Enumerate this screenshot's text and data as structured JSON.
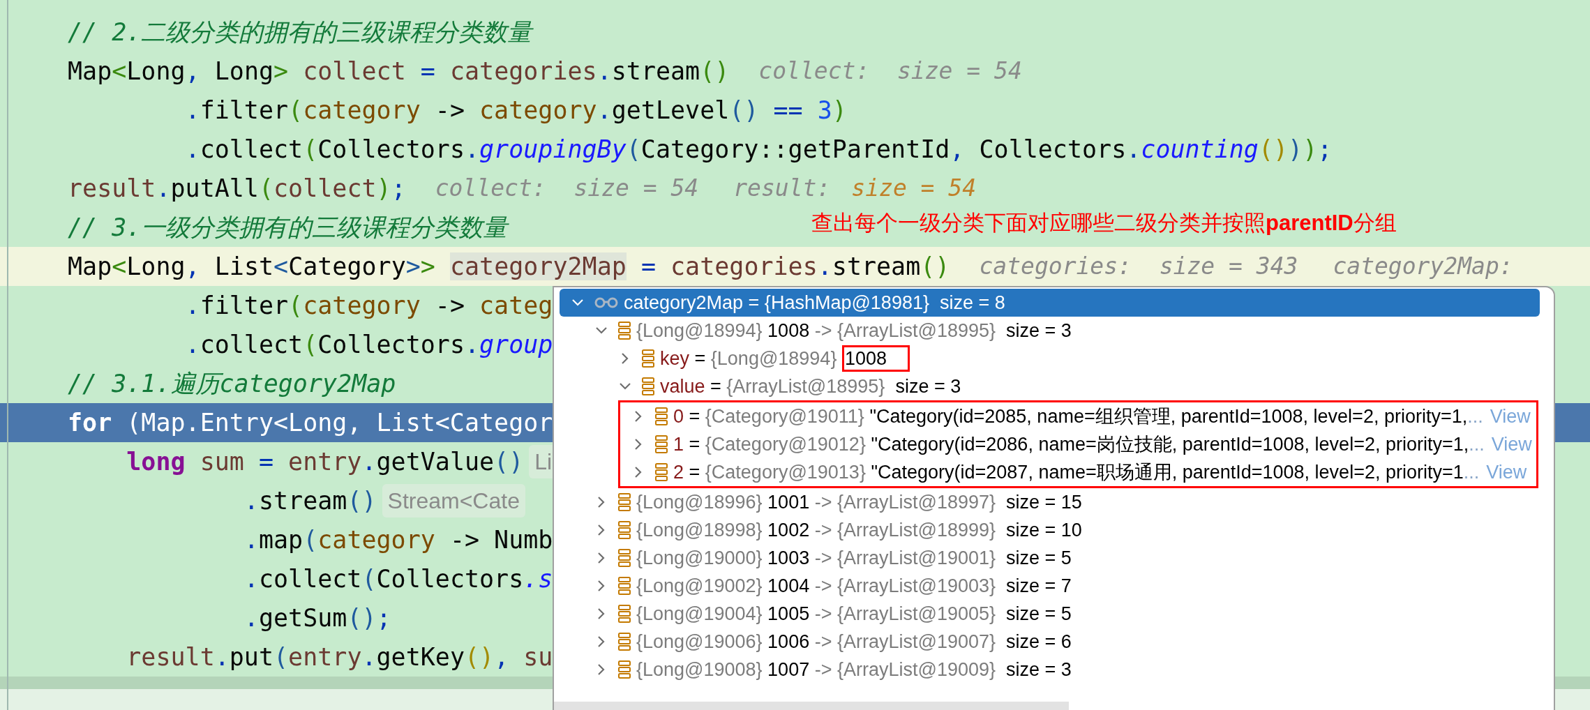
{
  "code_lines": [
    {
      "kind": "comment",
      "current": false,
      "paused": false,
      "text": "// 2.二级分类的拥有的三级课程分类数量"
    },
    {
      "kind": "code",
      "current": false,
      "paused": false,
      "tokens": [
        {
          "text": "Map",
          "kind": "plain"
        },
        {
          "text": "<",
          "kind": "bracket-green"
        },
        {
          "text": "Long",
          "kind": "plain"
        },
        {
          "text": ", ",
          "kind": "operator"
        },
        {
          "text": "Long",
          "kind": "plain"
        },
        {
          "text": ">",
          "kind": "bracket-green"
        },
        {
          "text": " collect ",
          "kind": "variable"
        },
        {
          "text": "=",
          "kind": "operator"
        },
        {
          "text": " categories",
          "kind": "variable"
        },
        {
          "text": ".",
          "kind": "operator"
        },
        {
          "text": "stream",
          "kind": "plain"
        },
        {
          "text": "()",
          "kind": "bracket-green"
        }
      ],
      "hints": [
        {
          "text": "collect:  size = 54",
          "kind": "value"
        }
      ]
    },
    {
      "kind": "code",
      "current": false,
      "paused": false,
      "tokens": [
        {
          "text": "        .",
          "kind": "operator"
        },
        {
          "text": "filter",
          "kind": "plain"
        },
        {
          "text": "(",
          "kind": "bracket-green"
        },
        {
          "text": "category",
          "kind": "parameter"
        },
        {
          "text": " -> ",
          "kind": "plain"
        },
        {
          "text": "category",
          "kind": "parameter"
        },
        {
          "text": ".",
          "kind": "operator"
        },
        {
          "text": "getLevel",
          "kind": "plain"
        },
        {
          "text": "()",
          "kind": "bracket-blue"
        },
        {
          "text": " == ",
          "kind": "operator"
        },
        {
          "text": "3",
          "kind": "number"
        },
        {
          "text": ")",
          "kind": "bracket-green"
        }
      ]
    },
    {
      "kind": "code",
      "current": false,
      "paused": false,
      "tokens": [
        {
          "text": "        .",
          "kind": "operator"
        },
        {
          "text": "collect",
          "kind": "plain"
        },
        {
          "text": "(",
          "kind": "bracket-green"
        },
        {
          "text": "Collectors",
          "kind": "plain"
        },
        {
          "text": ".",
          "kind": "operator"
        },
        {
          "text": "groupingBy",
          "kind": "static-call"
        },
        {
          "text": "(",
          "kind": "bracket-blue"
        },
        {
          "text": "Category::getParentId",
          "kind": "plain"
        },
        {
          "text": ", ",
          "kind": "operator"
        },
        {
          "text": "Collectors",
          "kind": "plain"
        },
        {
          "text": ".",
          "kind": "operator"
        },
        {
          "text": "counting",
          "kind": "static-call"
        },
        {
          "text": "()",
          "kind": "bracket-gold"
        },
        {
          "text": ")",
          "kind": "bracket-blue"
        },
        {
          "text": ")",
          "kind": "bracket-green"
        },
        {
          "text": ";",
          "kind": "operator"
        }
      ]
    },
    {
      "kind": "code",
      "current": false,
      "paused": false,
      "tokens": [
        {
          "text": "result",
          "kind": "variable"
        },
        {
          "text": ".",
          "kind": "operator"
        },
        {
          "text": "putAll",
          "kind": "plain"
        },
        {
          "text": "(",
          "kind": "bracket-green"
        },
        {
          "text": "collect",
          "kind": "variable"
        },
        {
          "text": ")",
          "kind": "bracket-green"
        },
        {
          "text": ";",
          "kind": "operator"
        }
      ],
      "hints": [
        {
          "text": "collect:  size = 54",
          "kind": "value"
        },
        {
          "text": "result:",
          "kind": "value"
        },
        {
          "text": "size = 54",
          "kind": "changed"
        }
      ]
    },
    {
      "kind": "comment",
      "current": false,
      "paused": false,
      "text": "// 3.一级分类拥有的三级课程分类数量"
    },
    {
      "kind": "code",
      "current": true,
      "paused": false,
      "tokens": [
        {
          "text": "Map",
          "kind": "plain"
        },
        {
          "text": "<",
          "kind": "bracket-green"
        },
        {
          "text": "Long",
          "kind": "plain"
        },
        {
          "text": ", ",
          "kind": "operator"
        },
        {
          "text": "List",
          "kind": "plain"
        },
        {
          "text": "<",
          "kind": "bracket-blue"
        },
        {
          "text": "Category",
          "kind": "plain"
        },
        {
          "text": ">",
          "kind": "bracket-blue"
        },
        {
          "text": "> ",
          "kind": "bracket-green"
        },
        {
          "text": "category2Map",
          "kind": "variable-marked"
        },
        {
          "text": " = ",
          "kind": "operator"
        },
        {
          "text": "categories",
          "kind": "variable"
        },
        {
          "text": ".",
          "kind": "operator"
        },
        {
          "text": "stream",
          "kind": "plain"
        },
        {
          "text": "()",
          "kind": "bracket-green"
        }
      ],
      "hints": [
        {
          "text": "categories:  size = 343",
          "kind": "value"
        },
        {
          "text": "category2Map:",
          "kind": "value"
        }
      ]
    },
    {
      "kind": "code",
      "current": false,
      "paused": false,
      "tokens": [
        {
          "text": "        .",
          "kind": "operator"
        },
        {
          "text": "filter",
          "kind": "plain"
        },
        {
          "text": "(",
          "kind": "bracket-green"
        },
        {
          "text": "category",
          "kind": "parameter"
        },
        {
          "text": " -> ",
          "kind": "plain"
        },
        {
          "text": "categ",
          "kind": "parameter"
        }
      ]
    },
    {
      "kind": "code",
      "current": false,
      "paused": false,
      "tokens": [
        {
          "text": "        .",
          "kind": "operator"
        },
        {
          "text": "collect",
          "kind": "plain"
        },
        {
          "text": "(",
          "kind": "bracket-green"
        },
        {
          "text": "Collectors",
          "kind": "plain"
        },
        {
          "text": ".",
          "kind": "operator"
        },
        {
          "text": "group",
          "kind": "static-call"
        }
      ]
    },
    {
      "kind": "comment",
      "current": false,
      "paused": false,
      "text": "// 3.1.遍历category2Map"
    },
    {
      "kind": "code",
      "current": false,
      "paused": true,
      "tokens": [
        {
          "text": "for",
          "kind": "keyword"
        },
        {
          "text": " (Map.Entry<Long, List<Categor",
          "kind": "plain"
        }
      ]
    },
    {
      "kind": "code",
      "current": false,
      "paused": false,
      "tokens": [
        {
          "text": "    long",
          "kind": "keyword"
        },
        {
          "text": " sum ",
          "kind": "variable"
        },
        {
          "text": "=",
          "kind": "operator"
        },
        {
          "text": " entry",
          "kind": "variable"
        },
        {
          "text": ".",
          "kind": "operator"
        },
        {
          "text": "getValue",
          "kind": "plain"
        },
        {
          "text": "()",
          "kind": "bracket-blue"
        }
      ],
      "inlay": "Li"
    },
    {
      "kind": "code",
      "current": false,
      "paused": false,
      "tokens": [
        {
          "text": "            .",
          "kind": "operator"
        },
        {
          "text": "stream",
          "kind": "plain"
        },
        {
          "text": "()",
          "kind": "bracket-blue"
        }
      ],
      "inlay": "Stream<Cate"
    },
    {
      "kind": "code",
      "current": false,
      "paused": false,
      "tokens": [
        {
          "text": "            .",
          "kind": "operator"
        },
        {
          "text": "map",
          "kind": "plain"
        },
        {
          "text": "(",
          "kind": "bracket-blue"
        },
        {
          "text": "category",
          "kind": "parameter"
        },
        {
          "text": " -> ",
          "kind": "plain"
        },
        {
          "text": "Numb",
          "kind": "plain"
        }
      ]
    },
    {
      "kind": "code",
      "current": false,
      "paused": false,
      "tokens": [
        {
          "text": "            .",
          "kind": "operator"
        },
        {
          "text": "collect",
          "kind": "plain"
        },
        {
          "text": "(",
          "kind": "bracket-blue"
        },
        {
          "text": "Collectors",
          "kind": "plain"
        },
        {
          "text": ".s",
          "kind": "static-call"
        }
      ]
    },
    {
      "kind": "code",
      "current": false,
      "paused": false,
      "tokens": [
        {
          "text": "            .",
          "kind": "operator"
        },
        {
          "text": "getSum",
          "kind": "plain"
        },
        {
          "text": "()",
          "kind": "bracket-blue"
        },
        {
          "text": ";",
          "kind": "operator"
        }
      ]
    },
    {
      "kind": "code",
      "current": false,
      "paused": false,
      "tokens": [
        {
          "text": "    result",
          "kind": "variable"
        },
        {
          "text": ".",
          "kind": "operator"
        },
        {
          "text": "put",
          "kind": "plain"
        },
        {
          "text": "(",
          "kind": "bracket-blue"
        },
        {
          "text": "entry",
          "kind": "variable"
        },
        {
          "text": ".",
          "kind": "operator"
        },
        {
          "text": "getKey",
          "kind": "plain"
        },
        {
          "text": "()",
          "kind": "bracket-gold"
        },
        {
          "text": ", ",
          "kind": "operator"
        },
        {
          "text": "su",
          "kind": "variable"
        }
      ]
    }
  ],
  "annotation": {
    "text": "查出每个一级分类下面对应哪些二级分类并按照**parentID**分组"
  },
  "debugger_popup": {
    "nodes": [
      {
        "kind": "watch",
        "expanded": true,
        "selected": true,
        "parts": [
          {
            "text": "category2Map = {HashMap@18981}  size = 8"
          }
        ],
        "children": [
          {
            "kind": "field",
            "expanded": true,
            "selected": false,
            "parts": [
              {
                "text": "{Long@18994} ",
                "kind": "ref"
              },
              {
                "text": "1008",
                "kind": "plain"
              },
              {
                "text": " -> {ArrayList@18995}",
                "kind": "ref"
              },
              {
                "text": "  size = 3",
                "kind": "plain"
              }
            ],
            "children": [
              {
                "kind": "field",
                "expanded": false,
                "selected": false,
                "parts": [
                  {
                    "text": "key",
                    "kind": "field"
                  },
                  {
                    "text": " = ",
                    "kind": "plain"
                  },
                  {
                    "text": "{Long@18994} ",
                    "kind": "ref"
                  },
                  {
                    "text": "1008",
                    "boxed": true
                  }
                ]
              },
              {
                "kind": "field",
                "expanded": true,
                "selected": false,
                "boxed_children": true,
                "parts": [
                  {
                    "text": "value",
                    "kind": "field"
                  },
                  {
                    "text": " = ",
                    "kind": "plain"
                  },
                  {
                    "text": "{ArrayList@18995}",
                    "kind": "ref"
                  },
                  {
                    "text": "  size = 3",
                    "kind": "plain"
                  }
                ],
                "children": [
                  {
                    "kind": "field",
                    "expanded": false,
                    "selected": false,
                    "parts": [
                      {
                        "text": "0",
                        "kind": "field"
                      },
                      {
                        "text": " = ",
                        "kind": "plain"
                      },
                      {
                        "text": "{Category@19011} ",
                        "kind": "ref"
                      },
                      {
                        "text": "\"Category(id=2085, name=组织管理, parentId=1008, level=2, priority=1,",
                        "kind": "plain"
                      },
                      {
                        "text": "...",
                        "kind": "dim"
                      }
                    ],
                    "link": "View"
                  },
                  {
                    "kind": "field",
                    "expanded": false,
                    "selected": false,
                    "parts": [
                      {
                        "text": "1",
                        "kind": "field"
                      },
                      {
                        "text": " = ",
                        "kind": "plain"
                      },
                      {
                        "text": "{Category@19012} ",
                        "kind": "ref"
                      },
                      {
                        "text": "\"Category(id=2086, name=岗位技能, parentId=1008, level=2, priority=1,",
                        "kind": "plain"
                      },
                      {
                        "text": "...",
                        "kind": "dim"
                      }
                    ],
                    "link": "View"
                  },
                  {
                    "kind": "field",
                    "expanded": false,
                    "selected": false,
                    "parts": [
                      {
                        "text": "2",
                        "kind": "field"
                      },
                      {
                        "text": " = ",
                        "kind": "plain"
                      },
                      {
                        "text": "{Category@19013} ",
                        "kind": "ref"
                      },
                      {
                        "text": "\"Category(id=2087, name=职场通用, parentId=1008, level=2, priority=1",
                        "kind": "plain"
                      },
                      {
                        "text": "...",
                        "kind": "dim"
                      }
                    ],
                    "link": "View"
                  }
                ]
              }
            ]
          },
          {
            "kind": "field",
            "expanded": false,
            "selected": false,
            "parts": [
              {
                "text": "{Long@18996} ",
                "kind": "ref"
              },
              {
                "text": "1001",
                "kind": "plain"
              },
              {
                "text": " -> {ArrayList@18997}",
                "kind": "ref"
              },
              {
                "text": "  size = 15",
                "kind": "plain"
              }
            ]
          },
          {
            "kind": "field",
            "expanded": false,
            "selected": false,
            "parts": [
              {
                "text": "{Long@18998} ",
                "kind": "ref"
              },
              {
                "text": "1002",
                "kind": "plain"
              },
              {
                "text": " -> {ArrayList@18999}",
                "kind": "ref"
              },
              {
                "text": "  size = 10",
                "kind": "plain"
              }
            ]
          },
          {
            "kind": "field",
            "expanded": false,
            "selected": false,
            "parts": [
              {
                "text": "{Long@19000} ",
                "kind": "ref"
              },
              {
                "text": "1003",
                "kind": "plain"
              },
              {
                "text": " -> {ArrayList@19001}",
                "kind": "ref"
              },
              {
                "text": "  size = 5",
                "kind": "plain"
              }
            ]
          },
          {
            "kind": "field",
            "expanded": false,
            "selected": false,
            "parts": [
              {
                "text": "{Long@19002} ",
                "kind": "ref"
              },
              {
                "text": "1004",
                "kind": "plain"
              },
              {
                "text": " -> {ArrayList@19003}",
                "kind": "ref"
              },
              {
                "text": "  size = 7",
                "kind": "plain"
              }
            ]
          },
          {
            "kind": "field",
            "expanded": false,
            "selected": false,
            "parts": [
              {
                "text": "{Long@19004} ",
                "kind": "ref"
              },
              {
                "text": "1005",
                "kind": "plain"
              },
              {
                "text": " -> {ArrayList@19005}",
                "kind": "ref"
              },
              {
                "text": "  size = 5",
                "kind": "plain"
              }
            ]
          },
          {
            "kind": "field",
            "expanded": false,
            "selected": false,
            "parts": [
              {
                "text": "{Long@19006} ",
                "kind": "ref"
              },
              {
                "text": "1006",
                "kind": "plain"
              },
              {
                "text": " -> {ArrayList@19007}",
                "kind": "ref"
              },
              {
                "text": "  size = 6",
                "kind": "plain"
              }
            ]
          },
          {
            "kind": "field",
            "expanded": false,
            "selected": false,
            "parts": [
              {
                "text": "{Long@19008} ",
                "kind": "ref"
              },
              {
                "text": "1007",
                "kind": "plain"
              },
              {
                "text": " -> {ArrayList@19009}",
                "kind": "ref"
              },
              {
                "text": "  size = 3",
                "kind": "plain"
              }
            ]
          }
        ]
      }
    ]
  }
}
